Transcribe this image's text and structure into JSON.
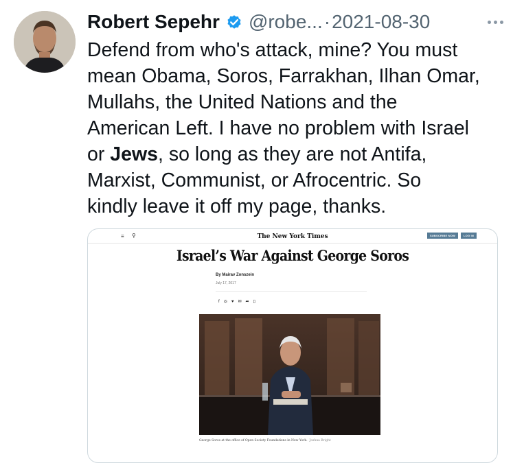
{
  "tweet": {
    "author_name": "Robert Sepehr",
    "handle": "@robe...",
    "separator": "·",
    "date": "2021-08-30",
    "text_lines": [
      "Defend from who's attack, mine? You must",
      "mean Obama, Soros, Farrakhan, Ilhan Omar,",
      "Mullahs, the United Nations and the",
      "American Left. I have no problem with Israel"
    ],
    "line5_prefix": "or ",
    "line5_bold": "Jews",
    "line5_suffix": ", so long as they are not Antifa,",
    "text_lines_end": [
      "Marxist, Communist, or Afrocentric. So",
      "kindly leave it off my page, thanks."
    ]
  },
  "article": {
    "masthead": "The New York Times",
    "subscribe_label": "SUBSCRIBE NOW",
    "login_label": "LOG IN",
    "headline": "Israel’s War Against George Soros",
    "byline": "By Mairav Zonszein",
    "date": "July 17, 2017",
    "caption": "George Soros at the office of Open Society Foundations in New York.",
    "credit": "Joshua Bright"
  },
  "icons": [
    "verified-badge-icon",
    "more-options-icon",
    "menu-icon",
    "search-icon",
    "facebook-icon",
    "whatsapp-icon",
    "twitter-icon",
    "email-icon",
    "share-icon",
    "bookmark-icon"
  ],
  "colors": {
    "verified": "#1d9bf0",
    "secondary_text": "#536471",
    "nyt_button": "#567b95"
  }
}
